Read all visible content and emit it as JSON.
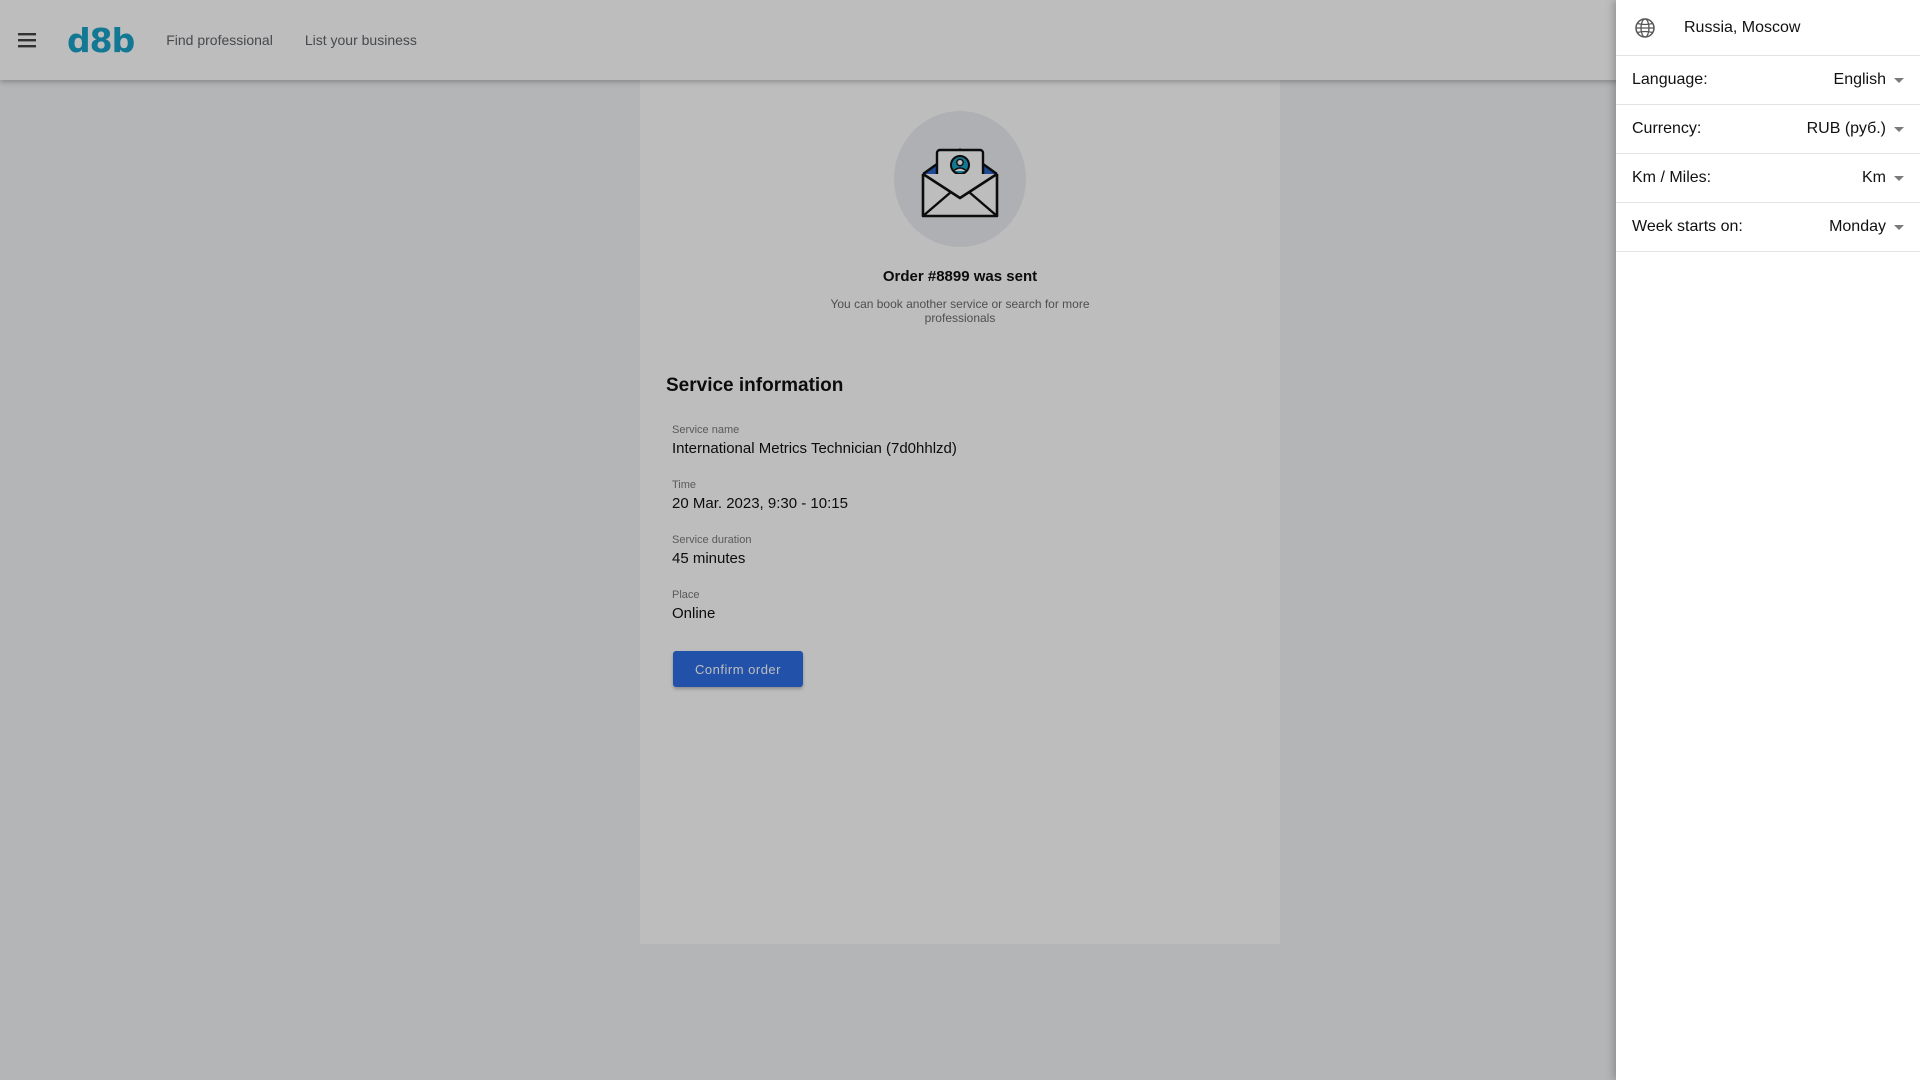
{
  "header": {
    "logo": "d8b",
    "nav": [
      "Find professional",
      "List your business"
    ]
  },
  "confirmation": {
    "title": "Order #8899 was sent",
    "subtitle": "You can book another service or search for more professionals"
  },
  "service": {
    "heading": "Service information",
    "fields": [
      {
        "label": "Service name",
        "value": "International Metrics Technician (7d0hhlzd)"
      },
      {
        "label": "Time",
        "value": "20 Mar. 2023, 9:30 - 10:15"
      },
      {
        "label": "Service duration",
        "value": "45 minutes"
      },
      {
        "label": "Place",
        "value": "Online"
      }
    ],
    "confirm_label": "Confirm order"
  },
  "settings": {
    "location": "Russia, Moscow",
    "rows": [
      {
        "label": "Language:",
        "value": "English"
      },
      {
        "label": "Currency:",
        "value": "RUB (руб.)"
      },
      {
        "label": "Km / Miles:",
        "value": "Km"
      },
      {
        "label": "Week starts on:",
        "value": "Monday"
      }
    ]
  },
  "colors": {
    "brand": "#1aa3c7",
    "primary_button": "#2e6ee4"
  },
  "icons": {
    "menu": "hamburger-menu-icon",
    "hero": "envelope-contact-icon",
    "globe": "globe-icon",
    "dropdown": "caret-down-icon"
  }
}
